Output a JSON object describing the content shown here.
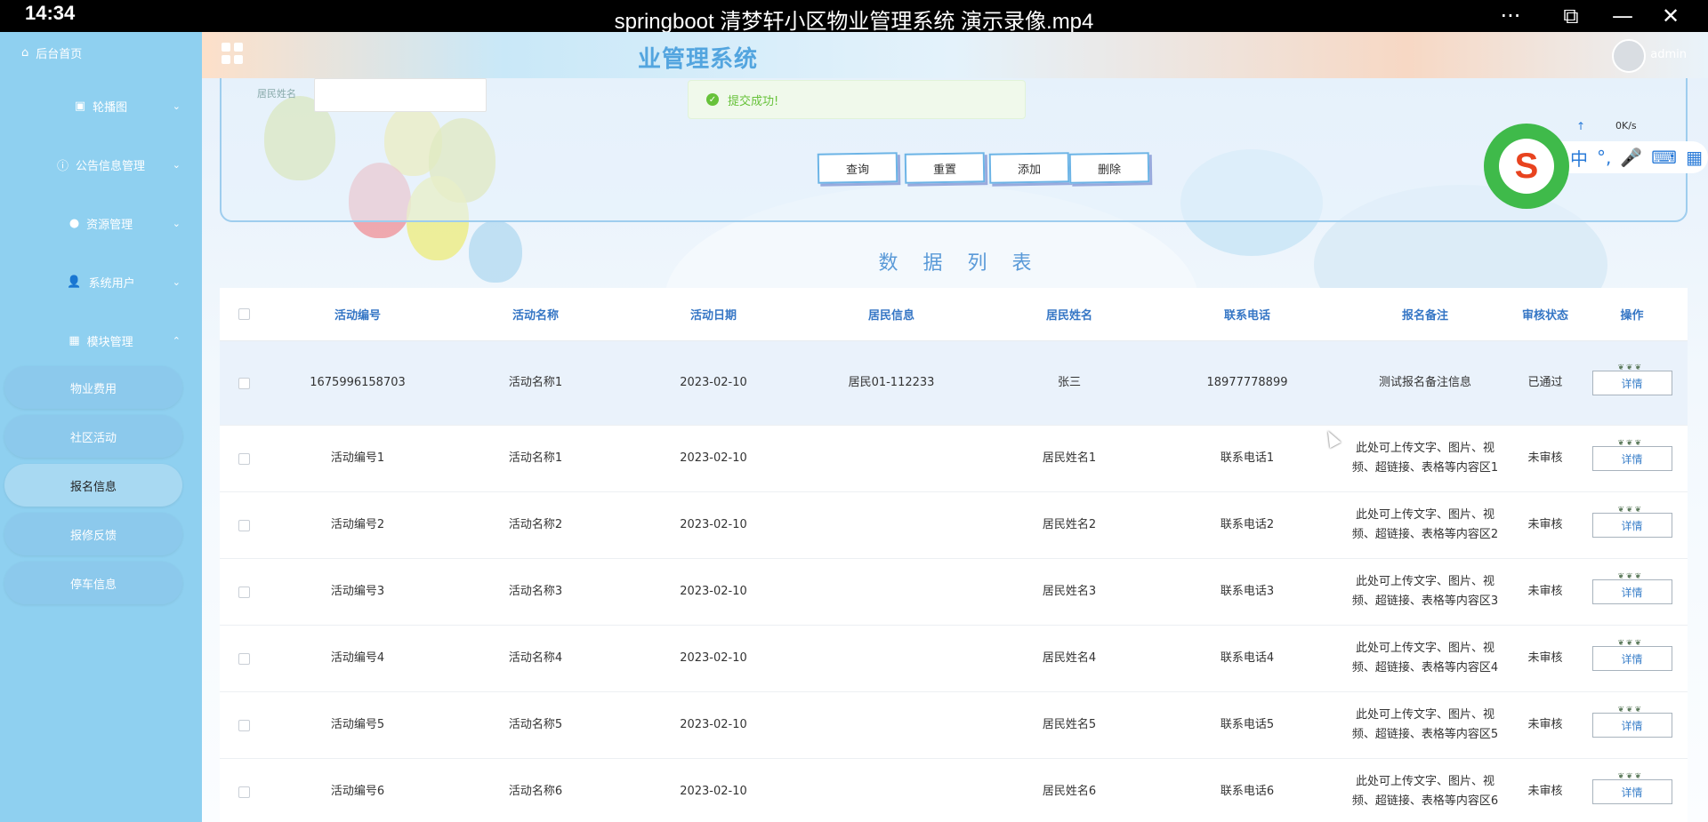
{
  "player": {
    "clock": "14:34",
    "title": "springboot 清梦轩小区物业管理系统 演示录像.mp4",
    "more_icon": "···",
    "pip_icon": "⧉",
    "minimize_icon": "—",
    "close_icon": "✕"
  },
  "header": {
    "system_title": "业管理系统",
    "user": "admin"
  },
  "toast": {
    "message": "提交成功!"
  },
  "ime": {
    "speed": "0K/s",
    "arrow": "↑",
    "logo": "S",
    "icons": [
      "中",
      "°,",
      "🎤",
      "⌨",
      "▦"
    ]
  },
  "sidebar": {
    "home": "后台首页",
    "menus": [
      {
        "label": "轮播图",
        "icon": "image-icon"
      },
      {
        "label": "公告信息管理",
        "icon": "info-icon"
      },
      {
        "label": "资源管理",
        "icon": "pin-icon"
      },
      {
        "label": "系统用户",
        "icon": "user-icon"
      },
      {
        "label": "模块管理",
        "icon": "grid-icon"
      }
    ],
    "submenu": [
      "物业费用",
      "社区活动",
      "报名信息",
      "报修反馈",
      "停车信息"
    ],
    "active_submenu": "报名信息"
  },
  "search": {
    "resident_name_label": "居民姓名",
    "resident_name_value": "",
    "buttons": {
      "query": "查询",
      "reset": "重置",
      "add": "添加",
      "delete": "删除"
    }
  },
  "list_title": "数据列表",
  "table": {
    "columns": [
      "活动编号",
      "活动名称",
      "活动日期",
      "居民信息",
      "居民姓名",
      "联系电话",
      "报名备注",
      "审核状态",
      "操作"
    ],
    "detail_label": "详情",
    "rows": [
      {
        "code": "1675996158703",
        "name": "活动名称1",
        "date": "2023-02-10",
        "resident_info": "居民01-112233",
        "resident_name": "张三",
        "phone": "18977778899",
        "note": "测试报名备注信息",
        "status": "已通过"
      },
      {
        "code": "活动编号1",
        "name": "活动名称1",
        "date": "2023-02-10",
        "resident_info": "",
        "resident_name": "居民姓名1",
        "phone": "联系电话1",
        "note": "此处可上传文字、图片、视频、超链接、表格等内容区1",
        "status": "未审核"
      },
      {
        "code": "活动编号2",
        "name": "活动名称2",
        "date": "2023-02-10",
        "resident_info": "",
        "resident_name": "居民姓名2",
        "phone": "联系电话2",
        "note": "此处可上传文字、图片、视频、超链接、表格等内容区2",
        "status": "未审核"
      },
      {
        "code": "活动编号3",
        "name": "活动名称3",
        "date": "2023-02-10",
        "resident_info": "",
        "resident_name": "居民姓名3",
        "phone": "联系电话3",
        "note": "此处可上传文字、图片、视频、超链接、表格等内容区3",
        "status": "未审核"
      },
      {
        "code": "活动编号4",
        "name": "活动名称4",
        "date": "2023-02-10",
        "resident_info": "",
        "resident_name": "居民姓名4",
        "phone": "联系电话4",
        "note": "此处可上传文字、图片、视频、超链接、表格等内容区4",
        "status": "未审核"
      },
      {
        "code": "活动编号5",
        "name": "活动名称5",
        "date": "2023-02-10",
        "resident_info": "",
        "resident_name": "居民姓名5",
        "phone": "联系电话5",
        "note": "此处可上传文字、图片、视频、超链接、表格等内容区5",
        "status": "未审核"
      },
      {
        "code": "活动编号6",
        "name": "活动名称6",
        "date": "2023-02-10",
        "resident_info": "",
        "resident_name": "居民姓名6",
        "phone": "联系电话6",
        "note": "此处可上传文字、图片、视频、超链接、表格等内容区6",
        "status": "未审核"
      }
    ]
  },
  "colors": {
    "sidebar": "#8fd0f0",
    "accent": "#3576c5",
    "success": "#67c23a"
  }
}
